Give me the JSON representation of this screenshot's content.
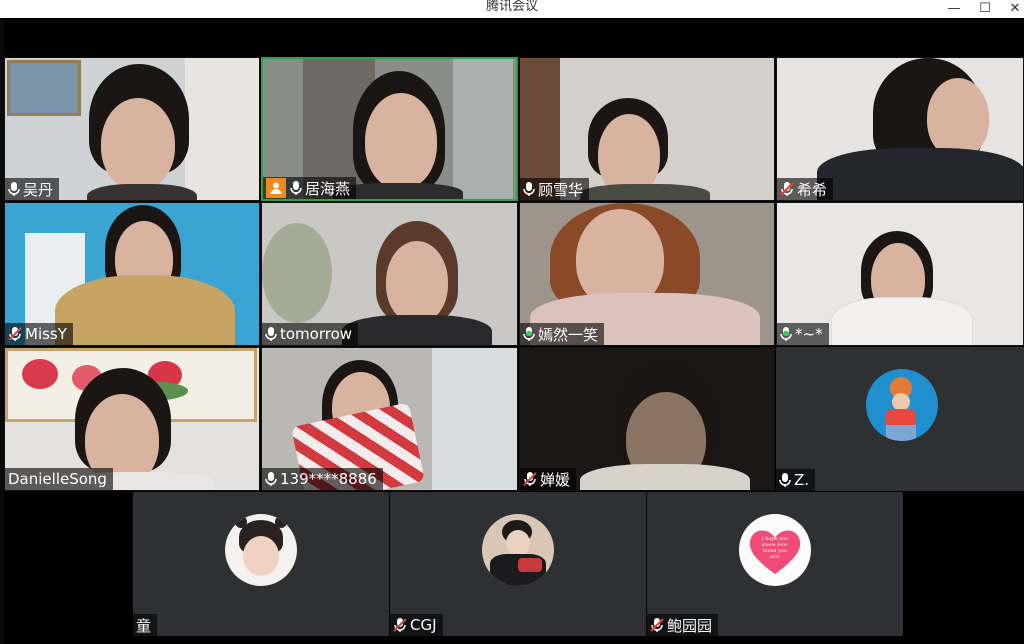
{
  "window": {
    "title": "腾讯会议"
  },
  "controls": {
    "minimize": "—",
    "maximize": "☐",
    "close": "✕"
  },
  "grid": [
    {
      "name": "吴丹",
      "mic": "on",
      "kind": "video",
      "host": false
    },
    {
      "name": "居海燕",
      "mic": "on",
      "kind": "video",
      "host": true,
      "speaking": true
    },
    {
      "name": "顾雪华",
      "mic": "on",
      "kind": "video",
      "host": false
    },
    {
      "name": "希希",
      "mic": "muted",
      "kind": "video",
      "host": false
    },
    {
      "name": "MissY",
      "mic": "muted",
      "kind": "video",
      "host": false
    },
    {
      "name": "tomorrow",
      "mic": "on",
      "kind": "video",
      "host": false
    },
    {
      "name": "嫣然一笑",
      "mic": "talking",
      "kind": "video",
      "host": false
    },
    {
      "name": "*~*",
      "mic": "talking",
      "kind": "video",
      "host": false
    },
    {
      "name": "DanielleSong",
      "mic": "none",
      "kind": "video",
      "host": false
    },
    {
      "name": "139****8886",
      "mic": "on",
      "kind": "video",
      "host": false
    },
    {
      "name": "婵媛",
      "mic": "muted",
      "kind": "video",
      "host": false
    },
    {
      "name": "Z.",
      "mic": "on",
      "kind": "avatar",
      "host": false
    },
    {
      "name": "童",
      "mic": "none",
      "kind": "avatar",
      "host": false
    },
    {
      "name": "CGJ",
      "mic": "muted",
      "kind": "avatar",
      "host": false
    },
    {
      "name": "鲍园园",
      "mic": "muted",
      "kind": "avatar",
      "host": false
    }
  ],
  "avatar_texts": {
    "heart_text": "I hope you know how loved you are!"
  },
  "icons": {
    "mic_on": "microphone-icon",
    "mic_muted": "microphone-muted-icon",
    "mic_talking": "microphone-active-icon",
    "host": "host-icon"
  },
  "colors": {
    "background": "#000000",
    "tile_bg": "#2e3033",
    "speaker_border": "#2ba34a",
    "host_badge": "#f08a1c",
    "muted_red": "#e0403a",
    "talking_green": "#2fd05c"
  }
}
